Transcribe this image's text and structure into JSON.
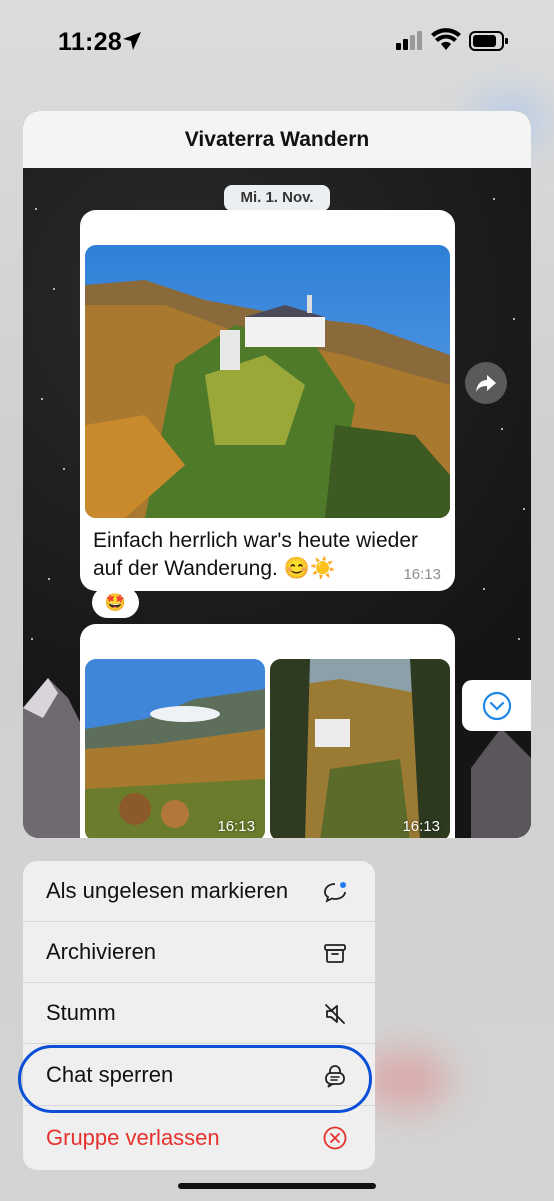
{
  "status_bar": {
    "time": "11:28"
  },
  "chat": {
    "title": "Vivaterra Wandern",
    "date_label": "Mi. 1. Nov.",
    "message1": {
      "text": "Einfach herrlich war's heute wieder auf der Wanderung. 😊☀️",
      "time": "16:13"
    },
    "reaction": "🤩",
    "message2": {
      "photo_times": [
        "16:13",
        "16:13"
      ]
    }
  },
  "menu": {
    "items": [
      {
        "label": "Als ungelesen markieren",
        "icon": "mark-unread-icon"
      },
      {
        "label": "Archivieren",
        "icon": "archive-icon"
      },
      {
        "label": "Stumm",
        "icon": "mute-icon"
      },
      {
        "label": "Chat sperren",
        "icon": "lock-chat-icon"
      },
      {
        "label": "Gruppe verlassen",
        "icon": "leave-group-icon"
      }
    ]
  },
  "colors": {
    "danger": "#e5322d",
    "highlight_ring": "#0a4fd6",
    "scroll_icon": "#1e88e5"
  }
}
